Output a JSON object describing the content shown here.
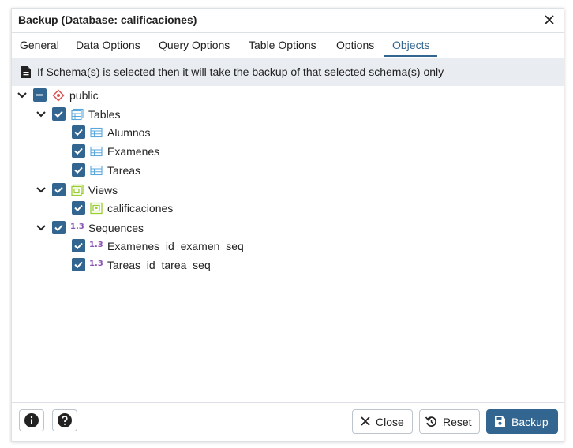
{
  "dialog": {
    "title": "Backup (Database: calificaciones)"
  },
  "tabs": [
    {
      "label": "General"
    },
    {
      "label": "Data Options"
    },
    {
      "label": "Query Options"
    },
    {
      "label": "Table Options"
    },
    {
      "label": "Options"
    },
    {
      "label": "Objects",
      "active": true
    }
  ],
  "info": {
    "text": "If Schema(s) is selected then it will take the backup of that selected schema(s) only",
    "icon": "document-icon"
  },
  "tree": {
    "schema": {
      "label": "public",
      "state": "indeterminate",
      "icon": "schema-icon"
    },
    "tables": {
      "label": "Tables",
      "state": "checked",
      "icon": "tables-icon",
      "items": [
        {
          "label": "Alumnos",
          "state": "checked",
          "icon": "table-icon"
        },
        {
          "label": "Examenes",
          "state": "checked",
          "icon": "table-icon"
        },
        {
          "label": "Tareas",
          "state": "checked",
          "icon": "table-icon"
        }
      ]
    },
    "views": {
      "label": "Views",
      "state": "checked",
      "icon": "views-icon",
      "items": [
        {
          "label": "calificaciones",
          "state": "checked",
          "icon": "view-icon"
        }
      ]
    },
    "sequences": {
      "label": "Sequences",
      "state": "checked",
      "icon_text": "1.3",
      "items": [
        {
          "label": "Examenes_id_examen_seq",
          "state": "checked",
          "icon_text": "1.3"
        },
        {
          "label": "Tareas_id_tarea_seq",
          "state": "checked",
          "icon_text": "1.3"
        }
      ]
    }
  },
  "footer": {
    "info_icon": "info-icon",
    "help_icon": "help-icon",
    "close_label": "Close",
    "reset_label": "Reset",
    "backup_label": "Backup"
  },
  "colors": {
    "primary": "#326690",
    "info_bar": "#e9ecf1",
    "views_icon": "#9acd32",
    "sequence_icon": "#8a55b5"
  }
}
